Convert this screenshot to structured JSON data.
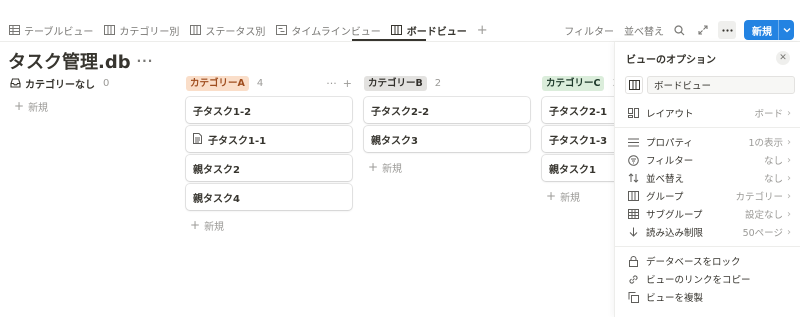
{
  "tabs": [
    {
      "label": "テーブルビュー",
      "icon": "table-icon"
    },
    {
      "label": "カテゴリー別",
      "icon": "board-icon"
    },
    {
      "label": "ステータス別",
      "icon": "board-icon"
    },
    {
      "label": "タイムラインビュー",
      "icon": "timeline-icon"
    },
    {
      "label": "ボードビュー",
      "icon": "board-icon",
      "active": true
    }
  ],
  "add_view": "+",
  "toolbar": {
    "filter": "フィルター",
    "sort": "並べ替え",
    "new_label": "新規"
  },
  "title": "タスク管理.db",
  "title_more": "···",
  "columns": [
    {
      "label": "カテゴリーなし",
      "count": "0",
      "add": "新規",
      "cards": []
    },
    {
      "label": "カテゴリーA",
      "count": "4",
      "color": "#fadec9",
      "text_color": "#9f4d1e",
      "add": "新規",
      "cards": [
        "子タスク1-2",
        "子タスク1-1",
        "親タスク2",
        "親タスク4"
      ]
    },
    {
      "label": "カテゴリーB",
      "count": "2",
      "color": "#e3e2e0",
      "text_color": "#32302c",
      "add": "新規",
      "cards": [
        "子タスク2-2",
        "親タスク3"
      ]
    },
    {
      "label": "カテゴリーC",
      "count": "3",
      "color": "#dbeddb",
      "text_color": "#1c3829",
      "add": "新規",
      "cards": [
        "子タスク2-1",
        "子タスク1-3",
        "親タスク1"
      ]
    }
  ],
  "panel": {
    "title": "ビューのオプション",
    "view_name": "ボードビュー",
    "rows": [
      {
        "label": "レイアウト",
        "value": "ボード",
        "icon": "layout-icon"
      },
      {
        "label": "プロパティ",
        "value": "1の表示",
        "icon": "list-icon"
      },
      {
        "label": "フィルター",
        "value": "なし",
        "icon": "filter-icon"
      },
      {
        "label": "並べ替え",
        "value": "なし",
        "icon": "sort-icon"
      },
      {
        "label": "グループ",
        "value": "カテゴリー",
        "icon": "group-icon"
      },
      {
        "label": "サブグループ",
        "value": "設定なし",
        "icon": "subgroup-icon"
      },
      {
        "label": "読み込み制限",
        "value": "50ページ",
        "icon": "arrow-down-icon"
      }
    ],
    "actions": [
      {
        "label": "データベースをロック",
        "icon": "lock-icon"
      },
      {
        "label": "ビューのリンクをコピー",
        "icon": "link-icon"
      },
      {
        "label": "ビューを複製",
        "icon": "duplicate-icon"
      }
    ]
  },
  "colors": {
    "accent": "#2383e2",
    "text": "#37352f",
    "muted": "#9b9a97"
  }
}
